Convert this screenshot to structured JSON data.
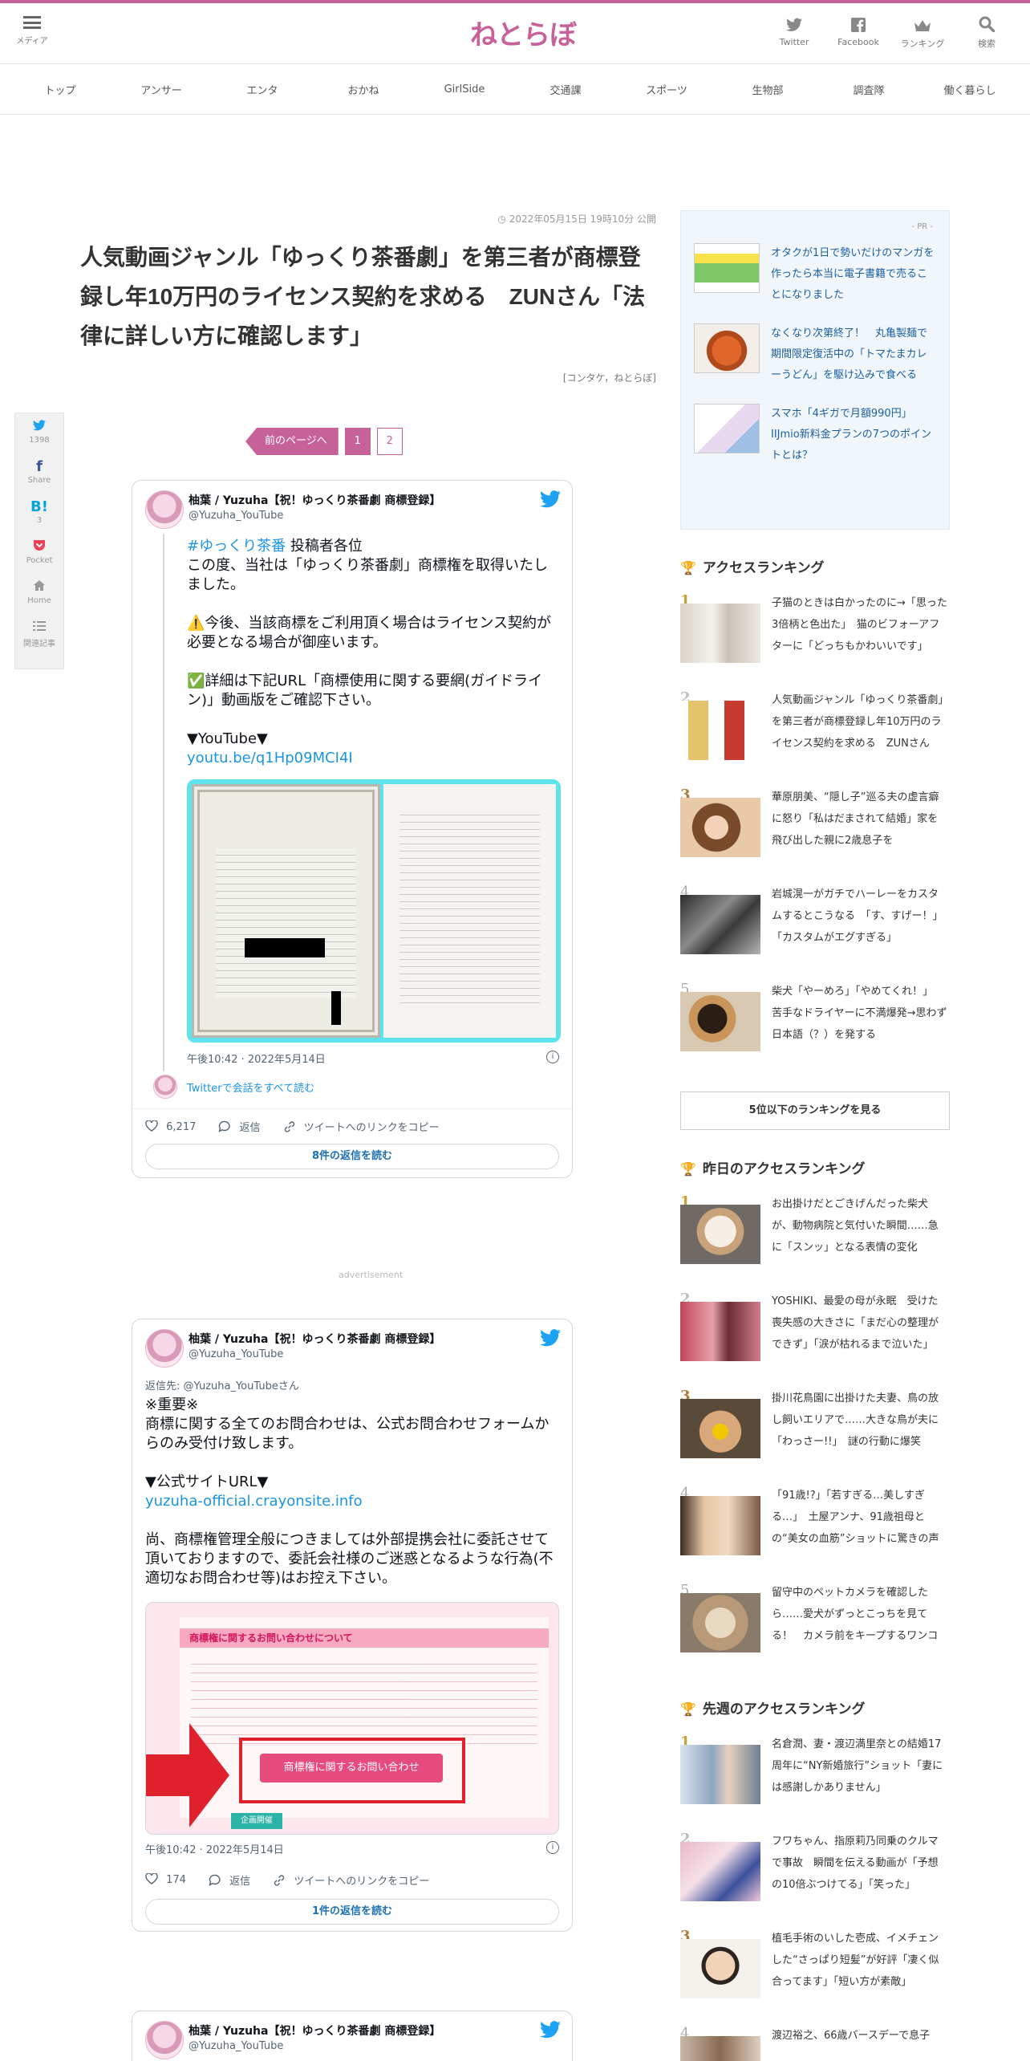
{
  "header": {
    "menu_label": "メディア",
    "logo": "ねとらぼ",
    "icons": [
      {
        "label": "Twitter",
        "icon": "twitter-icon"
      },
      {
        "label": "Facebook",
        "icon": "facebook-icon"
      },
      {
        "label": "ランキング",
        "icon": "crown-icon"
      },
      {
        "label": "検索",
        "icon": "search-icon"
      }
    ]
  },
  "nav": [
    "トップ",
    "アンサー",
    "エンタ",
    "おかね",
    "GirlSide",
    "交通課",
    "スポーツ",
    "生物部",
    "調査隊",
    "働く暮らし"
  ],
  "share": [
    {
      "label": "",
      "count": "1398",
      "icon": "twitter-icon"
    },
    {
      "label": "Share",
      "count": "",
      "icon": "facebook-icon"
    },
    {
      "label": "",
      "count": "3",
      "icon": "hatena-icon"
    },
    {
      "label": "Pocket",
      "count": "",
      "icon": "pocket-icon"
    },
    {
      "label": "Home",
      "count": "",
      "icon": "home-icon"
    },
    {
      "label": "関連記事",
      "count": "",
      "icon": "list-icon"
    }
  ],
  "article": {
    "date": "◷ 2022年05月15日 19時10分 公開",
    "title": "人気動画ジャンル「ゆっくり茶番劇」を第三者が商標登録し年10万円のライセンス契約を求める　ZUNさん「法律に詳しい方に確認します」",
    "credit": "[コンタケ，ねとらぼ]"
  },
  "pager": {
    "prev": "前のページへ",
    "pages": [
      "1",
      "2"
    ]
  },
  "tweet1": {
    "name": "柚葉 / Yuzuha【祝！ゆっくり茶番劇 商標登録】",
    "handle": "@Yuzuha_YouTube",
    "hashtag": "#ゆっくり茶番",
    "line1": " 投稿者各位",
    "body": "この度、当社は「ゆっくり茶番劇」商標権を取得いたしました。\n\n⚠️今後、当該商標をご利用頂く場合はライセンス契約が必要となる場合が御座います。\n\n✅詳細は下記URL「商標使用に関する要網(ガイドライン)」動画版をご確認下さい。\n\n▼YouTube▼",
    "link": "youtu.be/q1Hp09MCI4I",
    "time": "午後10:42 · 2022年5月14日",
    "thread_link": "Twitterで会話をすべて読む",
    "likes": "6,217",
    "reply": "返信",
    "copy": "ツイートへのリンクをコピー",
    "replies": "8件の返信を読む"
  },
  "ad_label": "advertisement",
  "tweet2": {
    "name": "柚葉 / Yuzuha【祝！ゆっくり茶番劇 商標登録】",
    "handle": "@Yuzuha_YouTube",
    "reply_to": "返信先: @Yuzuha_YouTubeさん",
    "body": "※重要※\n商標に関する全てのお問合わせは、公式お問合わせフォームからのみ受付け致します。\n\n▼公式サイトURL▼",
    "link": "yuzuha-official.crayonsite.info",
    "body2": "尚、商標権管理全般につきましては外部提携会社に委託させて頂いておりますので、委託会社様のご迷惑となるような行為(不適切なお問合わせ等)はお控え下さい。",
    "image_title": "商標権に関するお問い合わせについて",
    "image_button": "商標権に関するお問い合わせ",
    "image_badge": "企画開催",
    "time": "午後10:42 · 2022年5月14日",
    "likes": "174",
    "reply": "返信",
    "copy": "ツイートへのリンクをコピー",
    "replies": "1件の返信を読む"
  },
  "tweet3": {
    "name": "柚葉 / Yuzuha【祝！ゆっくり茶番劇 商標登録】",
    "handle": "@Yuzuha_YouTube"
  },
  "pr": {
    "label": "- PR -",
    "items": [
      "オタクが1日で勢いだけのマンガを作ったら本当に電子書籍で売ることになりました",
      "なくなり次第終了！　丸亀製麺で期間限定復活中の「トマたまカレーうどん」を駆け込みで食べる",
      "スマホ「4ギガで月額990円」IIJmio新料金プランの7つのポイントとは？"
    ]
  },
  "ranking": {
    "title": "アクセスランキング",
    "items": [
      "子猫のときは白かったのに→「思った3倍柄と色出た」　猫のビフォーアフターに「どっちもかわいいです」",
      "人気動画ジャンル「ゆっくり茶番劇」を第三者が商標登録し年10万円のライセンス契約を求める　ZUNさん",
      "華原朋美、“隠し子”巡る夫の虚言癖に怒り「私はだまされて結婚」家を飛び出した親に2歳息子を",
      "岩城滉一がガチでハーレーをカスタムするとこうなる　「す、すげー！」「カスタムがエグすぎる」",
      "柴犬「やーめろ」「やめてくれ！」　苦手なドライヤーに不満爆発→思わず日本語（？）を発する"
    ],
    "more": "5位以下のランキングを見る"
  },
  "yesterday": {
    "title": "昨日のアクセスランキング",
    "items": [
      "お出掛けだとごきげんだった柴犬が、動物病院と気付いた瞬間……急に「スンッ」となる表情の変化",
      "YOSHIKI、最愛の母が永眠　受けた喪失感の大きさに「まだ心の整理ができず」「涙が枯れるまで泣いた」",
      "掛川花鳥園に出掛けた夫妻、鳥の放し飼いエリアで……大きな鳥が夫に「わっさー!!」　謎の行動に爆笑",
      "「91歳!?」「若すぎる…美しすぎる…」　土屋アンナ、91歳祖母との“美女の血筋”ショットに驚きの声",
      "留守中のペットカメラを確認したら……愛犬がずっとこっちを見てる！　カメラ前をキープするワンコ"
    ]
  },
  "lastweek": {
    "title": "先週のアクセスランキング",
    "items": [
      "名倉潤、妻・渡辺満里奈との結婚17周年に“NY新婚旅行”ショット「妻には感謝しかありません」",
      "フワちゃん、指原莉乃同乗のクルマで事故　瞬間を伝える動画が「予想の10倍ぶつけてる」「笑った」",
      "植毛手術のいした壱成、イメチェンした“さっぱり短髪”が好評「凄く似合ってます」「短い方が素敵」",
      "渡辺裕之、66歳バースデーで息子"
    ]
  },
  "colors": {
    "brand": "#c7619a",
    "link": "#1b95e0",
    "pr_link": "#1a5e9e",
    "gold": "#c6a23a"
  }
}
